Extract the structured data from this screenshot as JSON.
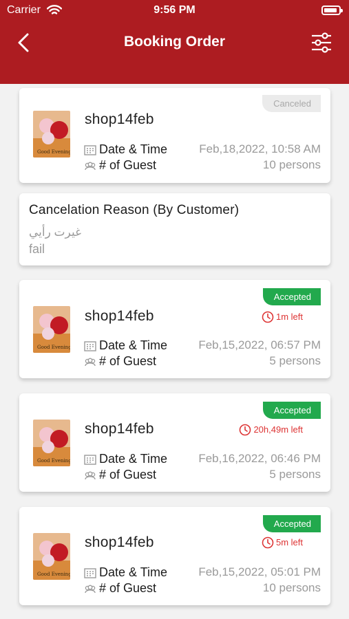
{
  "status_bar": {
    "carrier": "Carrier",
    "time": "9:56 PM"
  },
  "header": {
    "title": "Booking Order",
    "back_icon": "chevron-left-icon",
    "filter_icon": "sliders-icon"
  },
  "colors": {
    "brand": "#ad1c21",
    "accepted": "#22a94d",
    "canceled_bg": "#ebebeb",
    "timer": "#d33333"
  },
  "labels": {
    "date_time": "Date & Time",
    "guests": "# of Guest"
  },
  "orders": [
    {
      "shop": "shop14feb",
      "status": "Canceled",
      "timer": "",
      "datetime": "Feb,18,2022, 10:58 AM",
      "guests": "10 persons"
    },
    {
      "shop": "shop14feb",
      "status": "Accepted",
      "timer": "1m left",
      "datetime": "Feb,15,2022, 06:57 PM",
      "guests": "5 persons"
    },
    {
      "shop": "shop14feb",
      "status": "Accepted",
      "timer": "20h,49m left",
      "datetime": "Feb,16,2022, 06:46 PM",
      "guests": "5 persons"
    },
    {
      "shop": "shop14feb",
      "status": "Accepted",
      "timer": "5m left",
      "datetime": "Feb,15,2022, 05:01 PM",
      "guests": "10 persons"
    }
  ],
  "cancel_reason": {
    "title": "Cancelation Reason (By Customer)",
    "line_ar": "غيرت رأيي",
    "line_en": "fail"
  }
}
